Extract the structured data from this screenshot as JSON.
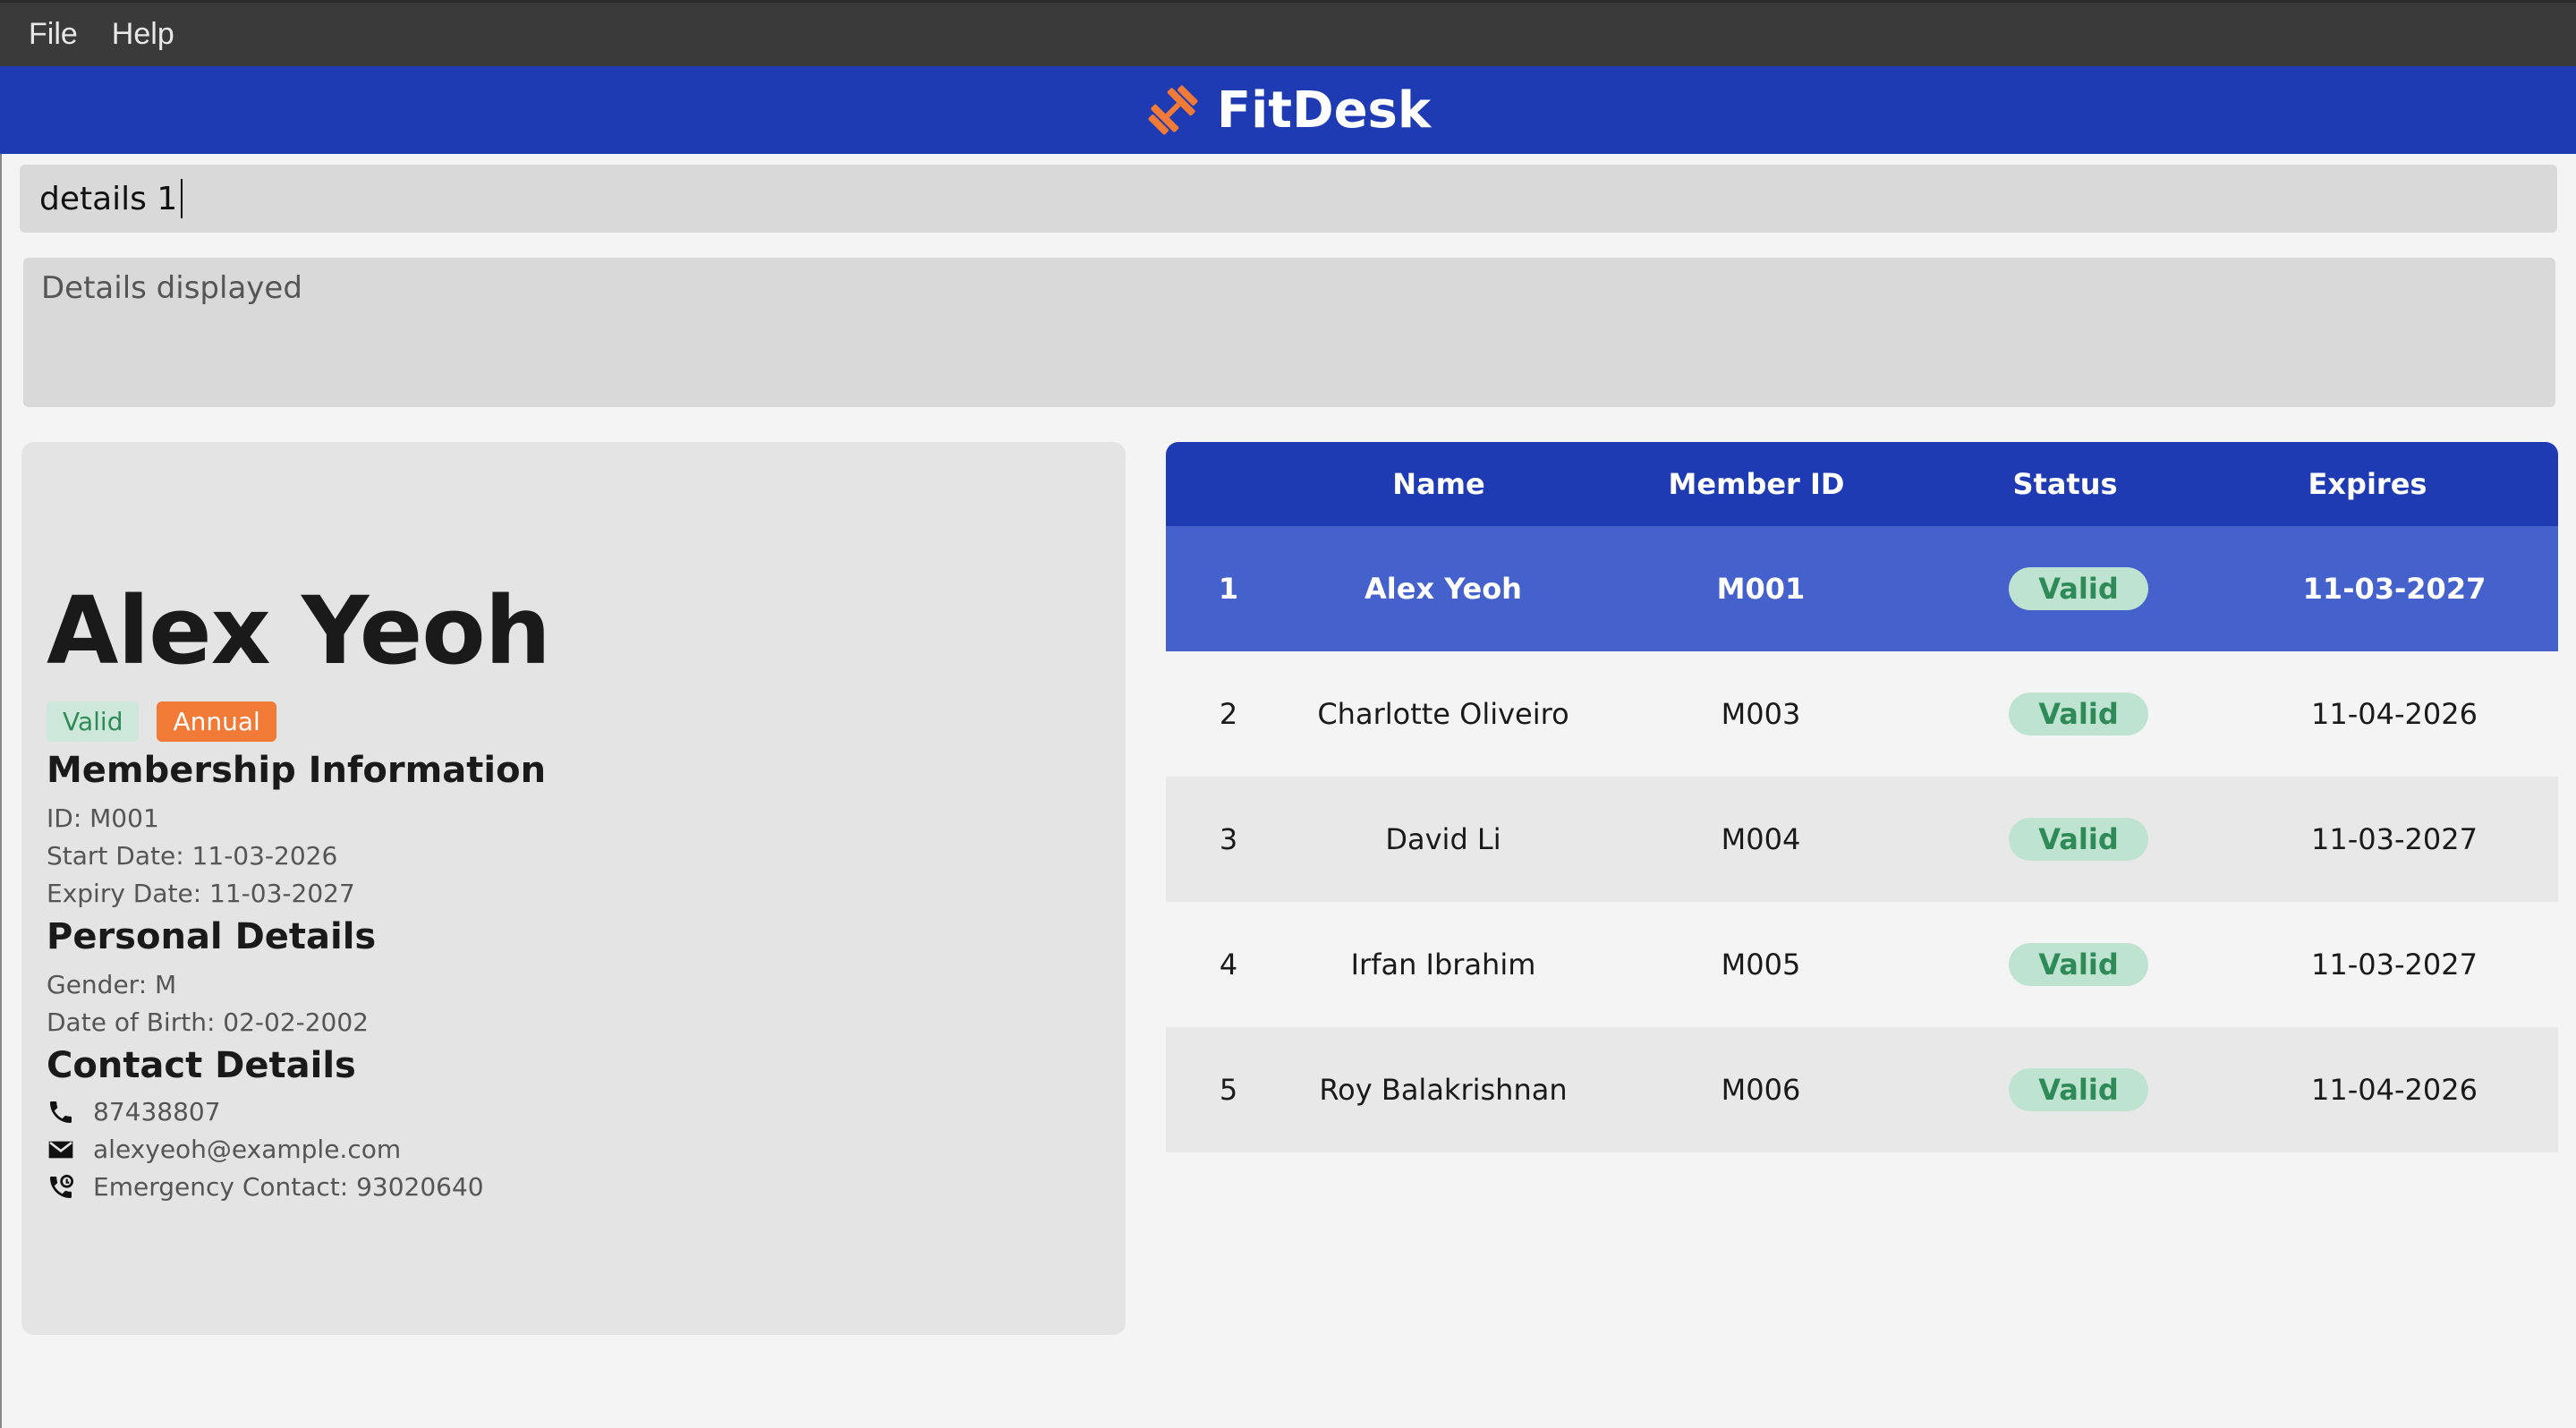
{
  "menu": [
    "File",
    "Help"
  ],
  "brand": {
    "title": "FitDesk",
    "accent": "#f07a36",
    "bar_color": "#1f3bb3"
  },
  "command": {
    "value": "details 1"
  },
  "result": {
    "text": "Details displayed"
  },
  "detail": {
    "name": "Alex Yeoh",
    "tags": [
      "Valid",
      "Annual"
    ],
    "membership_header": "Membership Information",
    "id_line": "ID: M001",
    "start_line": "Start Date: 11-03-2026",
    "expiry_line": "Expiry Date: 11-03-2027",
    "personal_header": "Personal Details",
    "gender_line": "Gender: M",
    "dob_line": "Date of Birth: 02-02-2002",
    "contact_header": "Contact Details",
    "phone": "87438807",
    "email": "alexyeoh@example.com",
    "emergency": "Emergency Contact: 93020640"
  },
  "table": {
    "headers": [
      "Name",
      "Member ID",
      "Status",
      "Expires"
    ],
    "rows": [
      {
        "idx": "1",
        "name": "Alex Yeoh",
        "id": "M001",
        "status": "Valid",
        "expires": "11-03-2027"
      },
      {
        "idx": "2",
        "name": "Charlotte Oliveiro",
        "id": "M003",
        "status": "Valid",
        "expires": "11-04-2026"
      },
      {
        "idx": "3",
        "name": "David Li",
        "id": "M004",
        "status": "Valid",
        "expires": "11-03-2027"
      },
      {
        "idx": "4",
        "name": "Irfan Ibrahim",
        "id": "M005",
        "status": "Valid",
        "expires": "11-03-2027"
      },
      {
        "idx": "5",
        "name": "Roy Balakrishnan",
        "id": "M006",
        "status": "Valid",
        "expires": "11-04-2026"
      }
    ]
  }
}
